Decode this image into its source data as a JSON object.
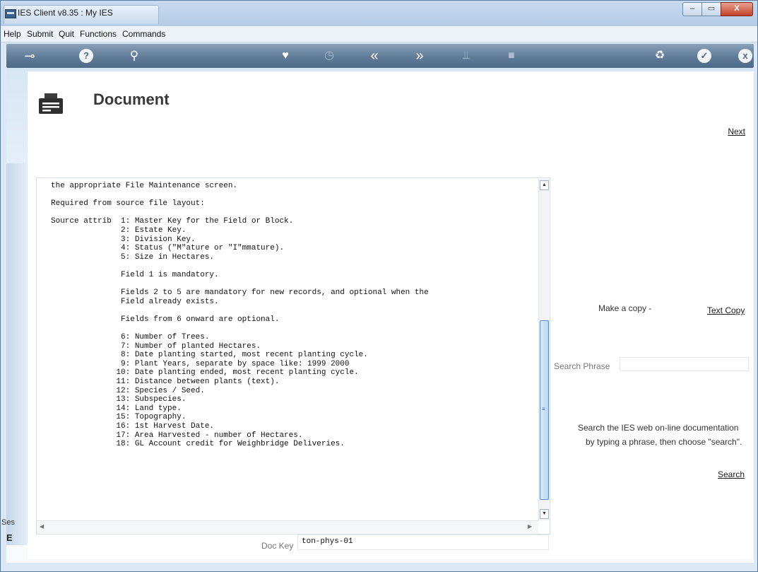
{
  "window": {
    "title": "IES Client v8.35 : My IES",
    "controls": {
      "minimize": "–",
      "maximize": "▭",
      "close": "X"
    }
  },
  "menu": {
    "items": [
      "Help",
      "Submit",
      "Quit",
      "Functions",
      "Commands"
    ]
  },
  "toolbar": {
    "icons": [
      "key-icon",
      "help-icon",
      "search-icon",
      "heart-icon",
      "clock-icon",
      "back-icon",
      "forward-icon",
      "tree-icon",
      "stop-icon",
      "recycle-icon",
      "check-icon",
      "close-icon"
    ]
  },
  "page": {
    "title": "Document",
    "next_label": "Next"
  },
  "document": {
    "lines": [
      "the appropriate File Maintenance screen.",
      "",
      "Required from source file layout:",
      "",
      "Source attrib  1: Master Key for the Field or Block.",
      "               2: Estate Key.",
      "               3: Division Key.",
      "               4: Status (\"M\"ature or \"I\"mmature).",
      "               5: Size in Hectares.",
      "",
      "               Field 1 is mandatory.",
      "",
      "               Fields 2 to 5 are mandatory for new records, and optional when the",
      "               Field already exists.",
      "",
      "               Fields from 6 onward are optional.",
      "",
      "               6: Number of Trees.",
      "               7: Number of planted Hectares.",
      "               8: Date planting started, most recent planting cycle.",
      "               9: Plant Years, separate by space like: 1999 2000",
      "              10: Date planting ended, most recent planting cycle.",
      "              11: Distance between plants (text).",
      "              12: Species / Seed.",
      "              13: Subspecies.",
      "              14: Land type.",
      "              15: Topography.",
      "              16: 1st Harvest Date.",
      "              17: Area Harvested - number of Hectares.",
      "              18: GL Account credit for Weighbridge Deliveries."
    ]
  },
  "copy": {
    "label": "Make a copy -",
    "link": "Text Copy"
  },
  "search": {
    "label": "Search Phrase",
    "value": "",
    "help_line1": "Search the IES web on-line documentation",
    "help_line2": "by typing a phrase, then choose \"search\".",
    "link": "Search"
  },
  "footer": {
    "session_label": "Ses",
    "session_sub": "E",
    "dockey_label": "Doc Key",
    "dockey_value": "ton-phys-01"
  },
  "colors": {
    "toolbar": "#5f7b97",
    "scroll_thumb": "#5a8fd1",
    "close_button": "#c2412a"
  }
}
